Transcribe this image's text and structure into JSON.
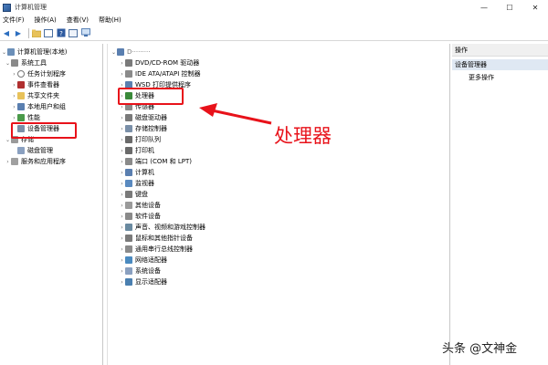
{
  "window": {
    "title": "计算机管理",
    "minimize": "—",
    "maximize": "☐",
    "close": "✕"
  },
  "menubar": [
    "文件(F)",
    "操作(A)",
    "查看(V)",
    "帮助(H)"
  ],
  "left_tree": {
    "root": "计算机管理(本地)",
    "system_tools": "系统工具",
    "task_scheduler": "任务计划程序",
    "event_viewer": "事件查看器",
    "shared_folders": "共享文件夹",
    "local_users": "本地用户和组",
    "performance": "性能",
    "device_manager": "设备管理器",
    "storage": "存储",
    "disk_management": "磁盘管理",
    "services_apps": "服务和应用程序"
  },
  "device_tree": {
    "root": "D·········",
    "items": [
      "DVD/CD-ROM 驱动器",
      "IDE ATA/ATAPI 控制器",
      "WSD 打印提供程序",
      "处理器",
      "传感器",
      "磁盘驱动器",
      "存储控制器",
      "打印队列",
      "打印机",
      "端口 (COM 和 LPT)",
      "计算机",
      "监视器",
      "键盘",
      "其他设备",
      "软件设备",
      "声音、视频和游戏控制器",
      "鼠标和其他指针设备",
      "通用串行总线控制器",
      "网络适配器",
      "系统设备",
      "显示适配器"
    ]
  },
  "actions": {
    "header": "操作",
    "section": "设备管理器",
    "more": "更多操作"
  },
  "annotation": {
    "label": "处理器",
    "color": "#e8121a"
  },
  "watermark": "头条 @文神金"
}
